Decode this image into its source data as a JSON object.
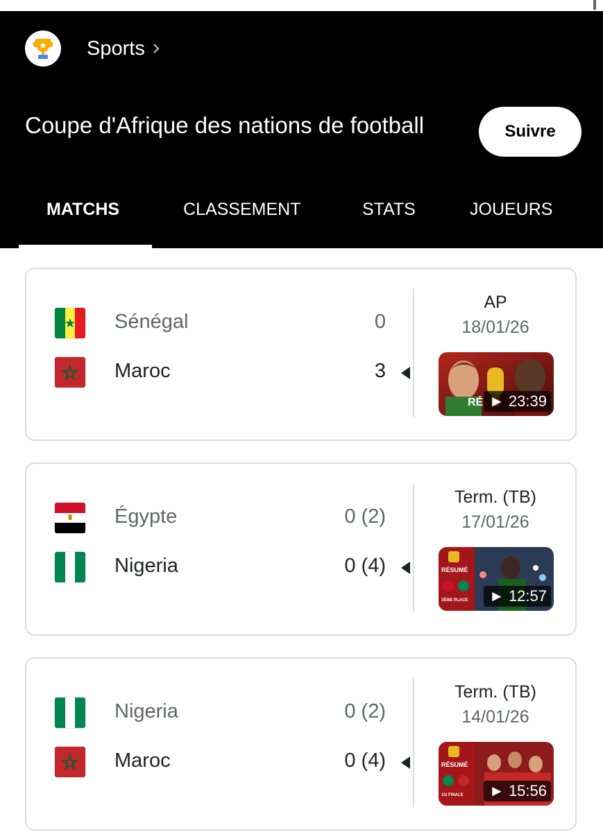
{
  "header": {
    "breadcrumb": "Sports",
    "title": "Coupe d'Afrique des nations de football",
    "follow_label": "Suivre",
    "icon": "trophy-icon"
  },
  "tabs": [
    {
      "label": "MATCHS",
      "active": true
    },
    {
      "label": "CLASSEMENT",
      "active": false
    },
    {
      "label": "STATS",
      "active": false
    },
    {
      "label": "JOUEURS",
      "active": false
    }
  ],
  "matches": [
    {
      "status": "AP",
      "date": "18/01/26",
      "team1": {
        "name": "Sénégal",
        "score": "0",
        "flag": "senegal-flag"
      },
      "team2": {
        "name": "Maroc",
        "score": "3",
        "flag": "morocco-flag"
      },
      "winner": 2,
      "video": {
        "duration": "23:39",
        "overlay_text": "RÉ"
      }
    },
    {
      "status": "Term. (TB)",
      "date": "17/01/26",
      "team1": {
        "name": "Égypte",
        "score": "0 (2)",
        "flag": "egypt-flag"
      },
      "team2": {
        "name": "Nigeria",
        "score": "0 (4)",
        "flag": "nigeria-flag"
      },
      "winner": 2,
      "video": {
        "duration": "12:57",
        "overlay_text": "RÉSUMÉ",
        "overlay_subtext": "3ÈME PLACE"
      }
    },
    {
      "status": "Term. (TB)",
      "date": "14/01/26",
      "team1": {
        "name": "Nigeria",
        "score": "0 (2)",
        "flag": "nigeria-flag"
      },
      "team2": {
        "name": "Maroc",
        "score": "0 (4)",
        "flag": "morocco-flag"
      },
      "winner": 2,
      "video": {
        "duration": "15:56",
        "overlay_text": "RÉSUMÉ",
        "overlay_subtext": "1/2 FINALE"
      }
    }
  ],
  "colors": {
    "header_bg": "#000000",
    "card_border": "#dadce0",
    "muted_text": "#5f6368",
    "primary_text": "#202124"
  }
}
